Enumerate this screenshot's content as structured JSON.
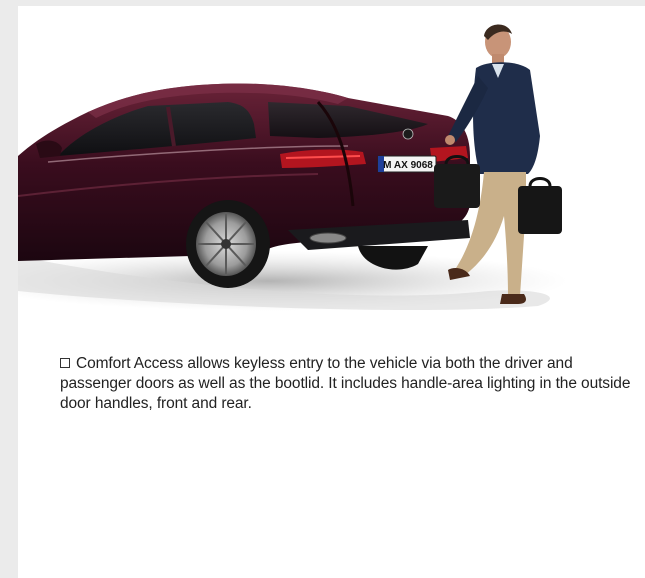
{
  "photo": {
    "plate_text": "M AX 9068"
  },
  "caption": {
    "text": "Comfort Access allows keyless entry to the vehicle via both the driver and passenger doors as well as the bootlid. It includes handle-area lighting in the outside door handles, front and rear."
  },
  "colors": {
    "car_body": "#3a0d1e",
    "page_background": "#ebebeb",
    "sheet_background": "#ffffff",
    "jacket": "#1f2d4a",
    "trousers": "#c9b08a"
  }
}
